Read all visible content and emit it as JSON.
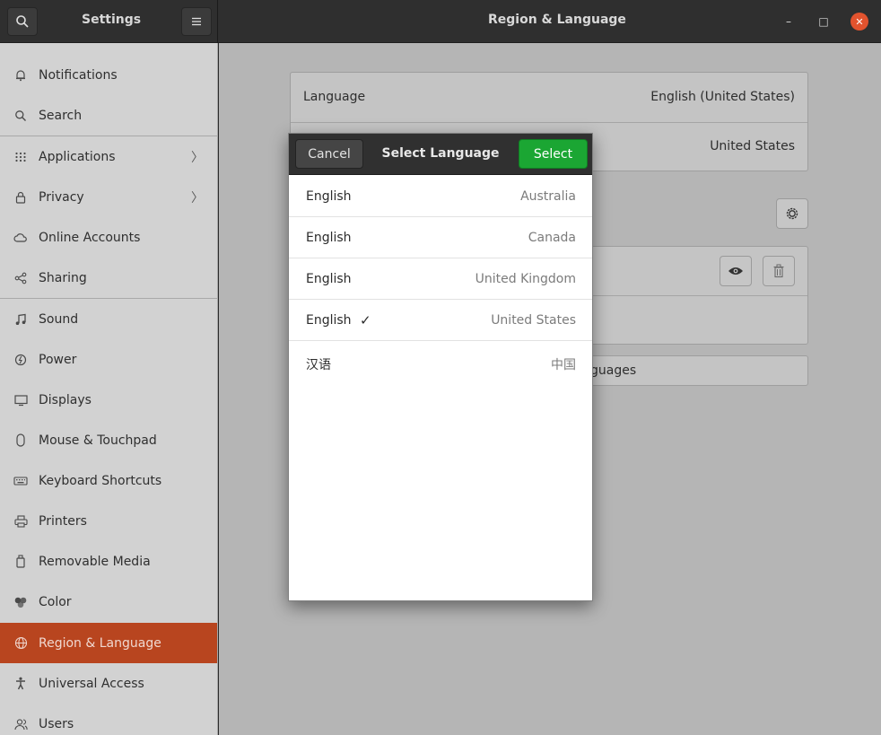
{
  "header": {
    "app_title": "Settings",
    "page_title": "Region & Language",
    "minimize": "–",
    "maximize": "□",
    "close": "✕"
  },
  "sidebar": {
    "items": [
      {
        "label": "Notifications",
        "icon": "bell-icon"
      },
      {
        "label": "Search",
        "icon": "search-icon"
      },
      {
        "label": "Applications",
        "icon": "grid-icon",
        "chevron": "〉"
      },
      {
        "label": "Privacy",
        "icon": "lock-icon",
        "chevron": "〉"
      },
      {
        "label": "Online Accounts",
        "icon": "cloud-icon"
      },
      {
        "label": "Sharing",
        "icon": "share-icon"
      },
      {
        "label": "Sound",
        "icon": "music-note-icon"
      },
      {
        "label": "Power",
        "icon": "power-icon"
      },
      {
        "label": "Displays",
        "icon": "display-icon"
      },
      {
        "label": "Mouse & Touchpad",
        "icon": "mouse-icon"
      },
      {
        "label": "Keyboard Shortcuts",
        "icon": "keyboard-icon"
      },
      {
        "label": "Printers",
        "icon": "printer-icon"
      },
      {
        "label": "Removable Media",
        "icon": "usb-drive-icon"
      },
      {
        "label": "Color",
        "icon": "color-icon"
      },
      {
        "label": "Region & Language",
        "icon": "globe-icon",
        "active": true
      },
      {
        "label": "Universal Access",
        "icon": "accessibility-icon"
      },
      {
        "label": "Users",
        "icon": "users-icon"
      }
    ]
  },
  "main": {
    "language_label": "Language",
    "language_value": "English (United States)",
    "formats_value": "United States",
    "manage_languages_partial": "guages"
  },
  "dialog": {
    "cancel_label": "Cancel",
    "title": "Select Language",
    "select_label": "Select",
    "check_mark": "✓",
    "languages": [
      {
        "name": "English",
        "region": "Australia"
      },
      {
        "name": "English",
        "region": "Canada"
      },
      {
        "name": "English",
        "region": "United Kingdom"
      },
      {
        "name": "English",
        "region": "United States",
        "selected": true
      },
      {
        "name": "汉语",
        "region": "中国"
      }
    ]
  },
  "colors": {
    "active_item": "#b8451f",
    "select_button": "#1ba633",
    "close_button": "#e2532e"
  }
}
